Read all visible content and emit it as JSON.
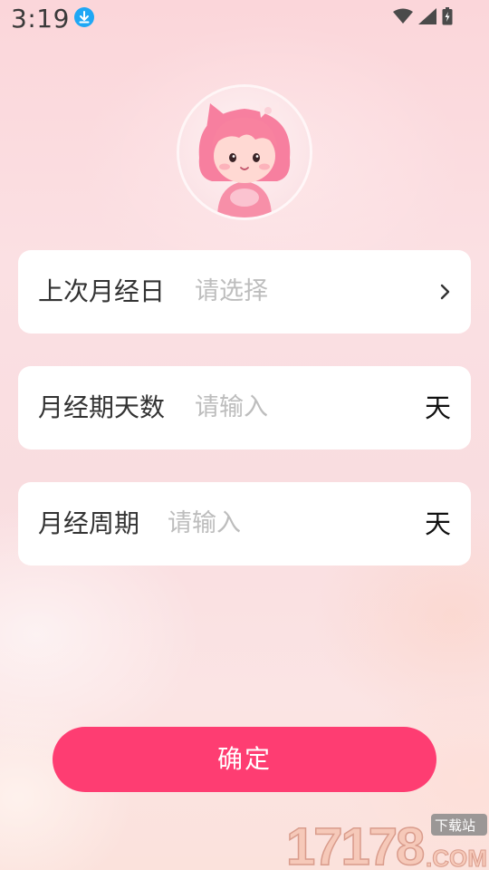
{
  "status_bar": {
    "time": "3:19",
    "icons": [
      "download-icon",
      "wifi-icon",
      "signal-icon",
      "battery-icon"
    ]
  },
  "avatar": {
    "icon": "cartoon-girl-avatar"
  },
  "form": {
    "last_period": {
      "label": "上次月经日",
      "placeholder": "请选择",
      "icon": "chevron-right-icon"
    },
    "period_days": {
      "label": "月经期天数",
      "placeholder": "请输入",
      "unit": "天"
    },
    "cycle": {
      "label": "月经周期",
      "placeholder": "请输入",
      "unit": "天"
    }
  },
  "confirm_button": {
    "label": "确定"
  },
  "watermark": {
    "number": "17178",
    "tag": "下载站",
    "domain": ".COM"
  },
  "colors": {
    "accent": "#fe3d72",
    "card": "#ffffff",
    "label_text": "#333333",
    "placeholder_text": "#bdbdbd",
    "download_badge": "#1ea7f5"
  }
}
